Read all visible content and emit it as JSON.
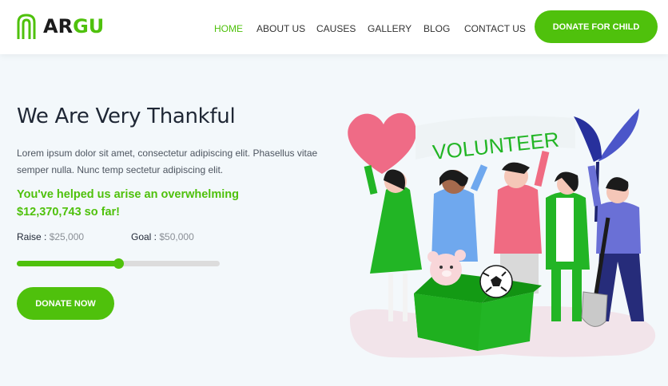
{
  "brand": {
    "name_part1": "AR",
    "name_part2": "GU",
    "accent": "#4fc10c"
  },
  "nav": {
    "items": [
      {
        "label": "HOME",
        "active": true
      },
      {
        "label": "ABOUT US",
        "active": false
      },
      {
        "label": "CAUSES",
        "active": false
      },
      {
        "label": "GALLERY",
        "active": false
      },
      {
        "label": "BLOG",
        "active": false
      },
      {
        "label": "CONTACT US",
        "active": false
      }
    ],
    "cta_label": "DONATE FOR CHILD"
  },
  "hero": {
    "title": "We Are Very Thankful",
    "description": "Lorem ipsum dolor sit amet, consectetur adipiscing elit. Phasellus vitae semper nulla. Nunc temp sectetur adipiscing elit.",
    "highlight": "You've helped us arise an overwhelming $12,370,743 so far!",
    "raise_label": "Raise :",
    "raise_value": "$25,000",
    "goal_label": "Goal :",
    "goal_value": "$50,000",
    "progress_fraction": 0.5,
    "donate_label": "DONATE NOW"
  },
  "illustration": {
    "banner_text": "VOLUNTEER"
  },
  "icons": [
    "logo-mark-icon",
    "heart-icon",
    "leaf-icon",
    "shovel-icon",
    "teddy-bear-icon",
    "soccer-ball-icon",
    "donation-box-icon"
  ]
}
